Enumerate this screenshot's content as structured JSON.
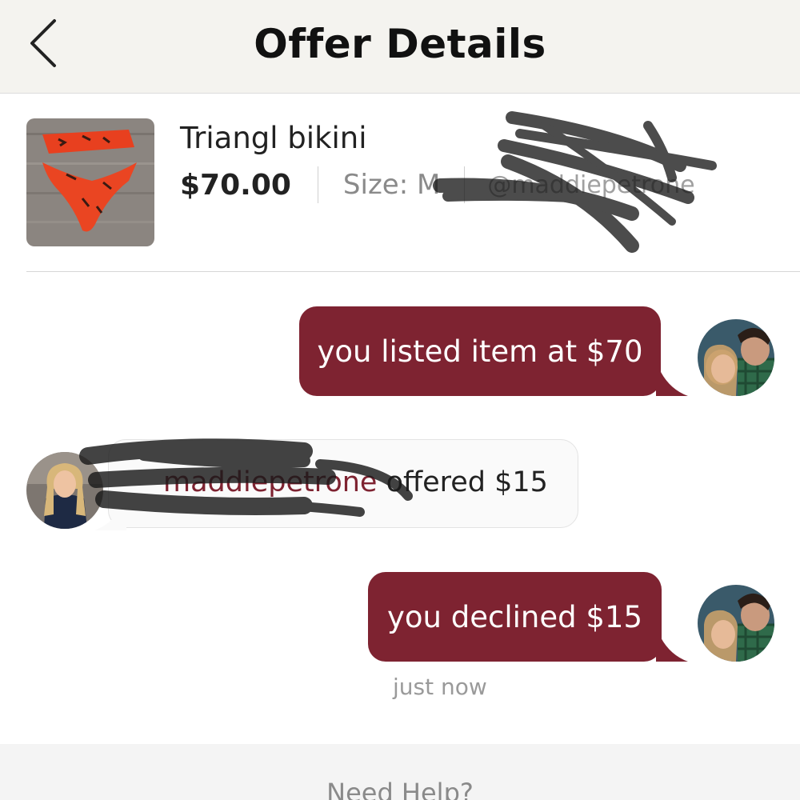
{
  "header": {
    "title": "Offer Details",
    "back_icon": "chevron-left-icon"
  },
  "listing": {
    "title": "Triangl bikini",
    "price": "$70.00",
    "size": "Size: M",
    "seller": "@maddiepetrone",
    "thumbnail_icon": "product-photo-bikini"
  },
  "messages": [
    {
      "text": "you listed item at $70",
      "side": "outgoing"
    },
    {
      "user": "maddiepetrone",
      "text": " offered $15",
      "side": "incoming"
    },
    {
      "text": "you declined $15",
      "side": "outgoing"
    }
  ],
  "timestamp": "just now",
  "footer": {
    "help_label": "Need Help?"
  },
  "colors": {
    "accent": "#7e2331",
    "header_bg": "#f4f3ef",
    "incoming_bubble": "#fafafa"
  }
}
